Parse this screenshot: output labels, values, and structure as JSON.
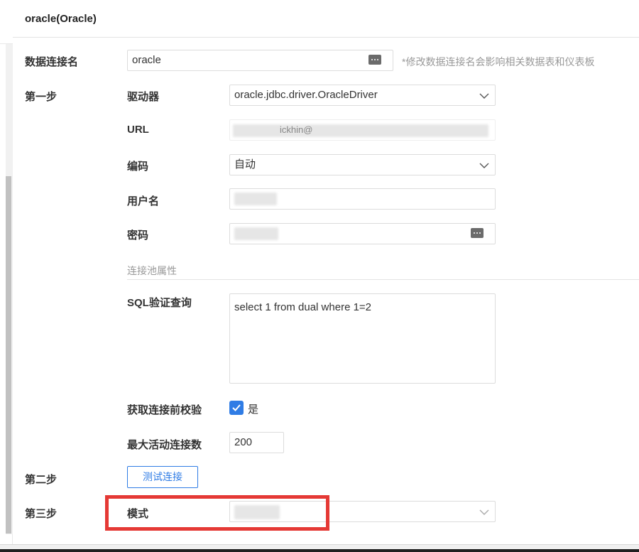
{
  "header": {
    "title": "oracle(Oracle)"
  },
  "connection_name": {
    "label": "数据连接名",
    "value": "oracle",
    "hint": "*修改数据连接名会影响相关数据表和仪表板"
  },
  "steps": {
    "step1": "第一步",
    "step2": "第二步",
    "step3": "第三步"
  },
  "driver": {
    "label": "驱动器",
    "value": "oracle.jdbc.driver.OracleDriver"
  },
  "url": {
    "label": "URL",
    "visible_fragment": "ickhin@"
  },
  "encoding": {
    "label": "编码",
    "value": "自动"
  },
  "username": {
    "label": "用户名"
  },
  "password": {
    "label": "密码"
  },
  "pool": {
    "section_title": "连接池属性",
    "sql_label": "SQL验证查询",
    "sql_value": "select 1 from dual where 1=2",
    "validate_label": "获取连接前校验",
    "validate_checked": true,
    "validate_option": "是",
    "max_active_label": "最大活动连接数",
    "max_active_value": "200"
  },
  "test_button": {
    "label": "测试连接"
  },
  "schema": {
    "label": "模式"
  },
  "colors": {
    "accent": "#2f7ce5",
    "highlight": "#e53935"
  }
}
